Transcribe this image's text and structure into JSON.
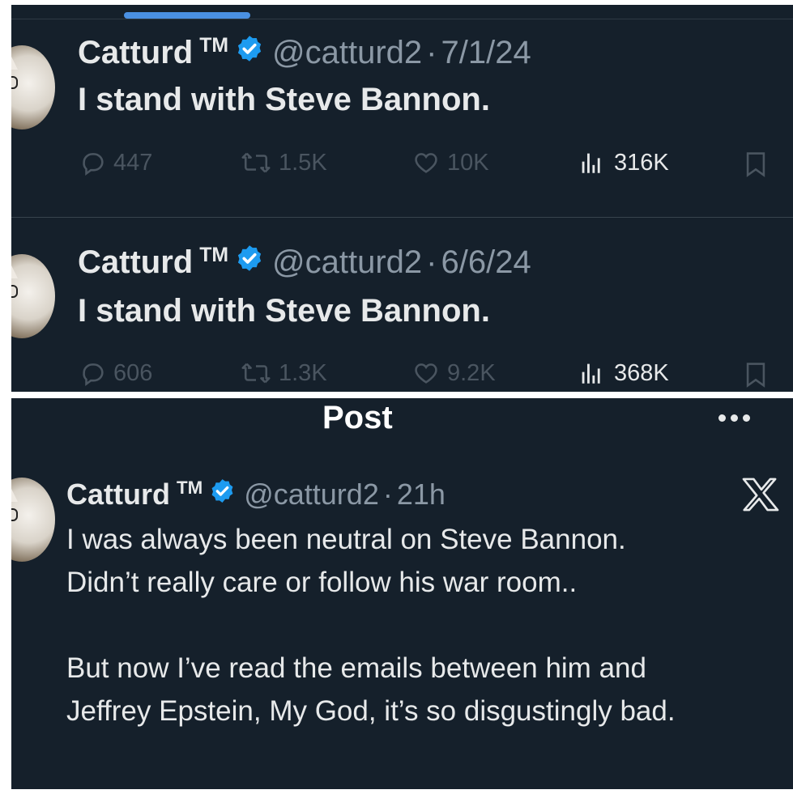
{
  "colors": {
    "background": "#15202b",
    "text": "#e7e9ea",
    "secondary_text": "#8b98a5",
    "verified_blue": "#1d9bf0",
    "tab_indicator": "#4a90e2"
  },
  "tweets": [
    {
      "display_name": "Catturd",
      "tm": "TM",
      "handle": "@catturd2",
      "separator": "·",
      "date": "7/1/24",
      "text": "I stand with Steve Bannon.",
      "replies": "447",
      "reposts": "1.5K",
      "likes": "10K",
      "views": "316K"
    },
    {
      "display_name": "Catturd",
      "tm": "TM",
      "handle": "@catturd2",
      "separator": "·",
      "date": "6/6/24",
      "text": "I stand with Steve Bannon.",
      "replies": "606",
      "reposts": "1.3K",
      "likes": "9.2K",
      "views": "368K"
    }
  ],
  "post_view": {
    "title": "Post",
    "tweet": {
      "display_name": "Catturd",
      "tm": "TM",
      "handle": "@catturd2",
      "separator": "·",
      "time": "21h",
      "lines": [
        "I was always been neutral on Steve Bannon.",
        "Didn’t really care or follow his war room..",
        "",
        "But now I’ve read the emails between him and",
        "Jeffrey Epstein, My God, it’s so disgustingly bad."
      ]
    }
  }
}
